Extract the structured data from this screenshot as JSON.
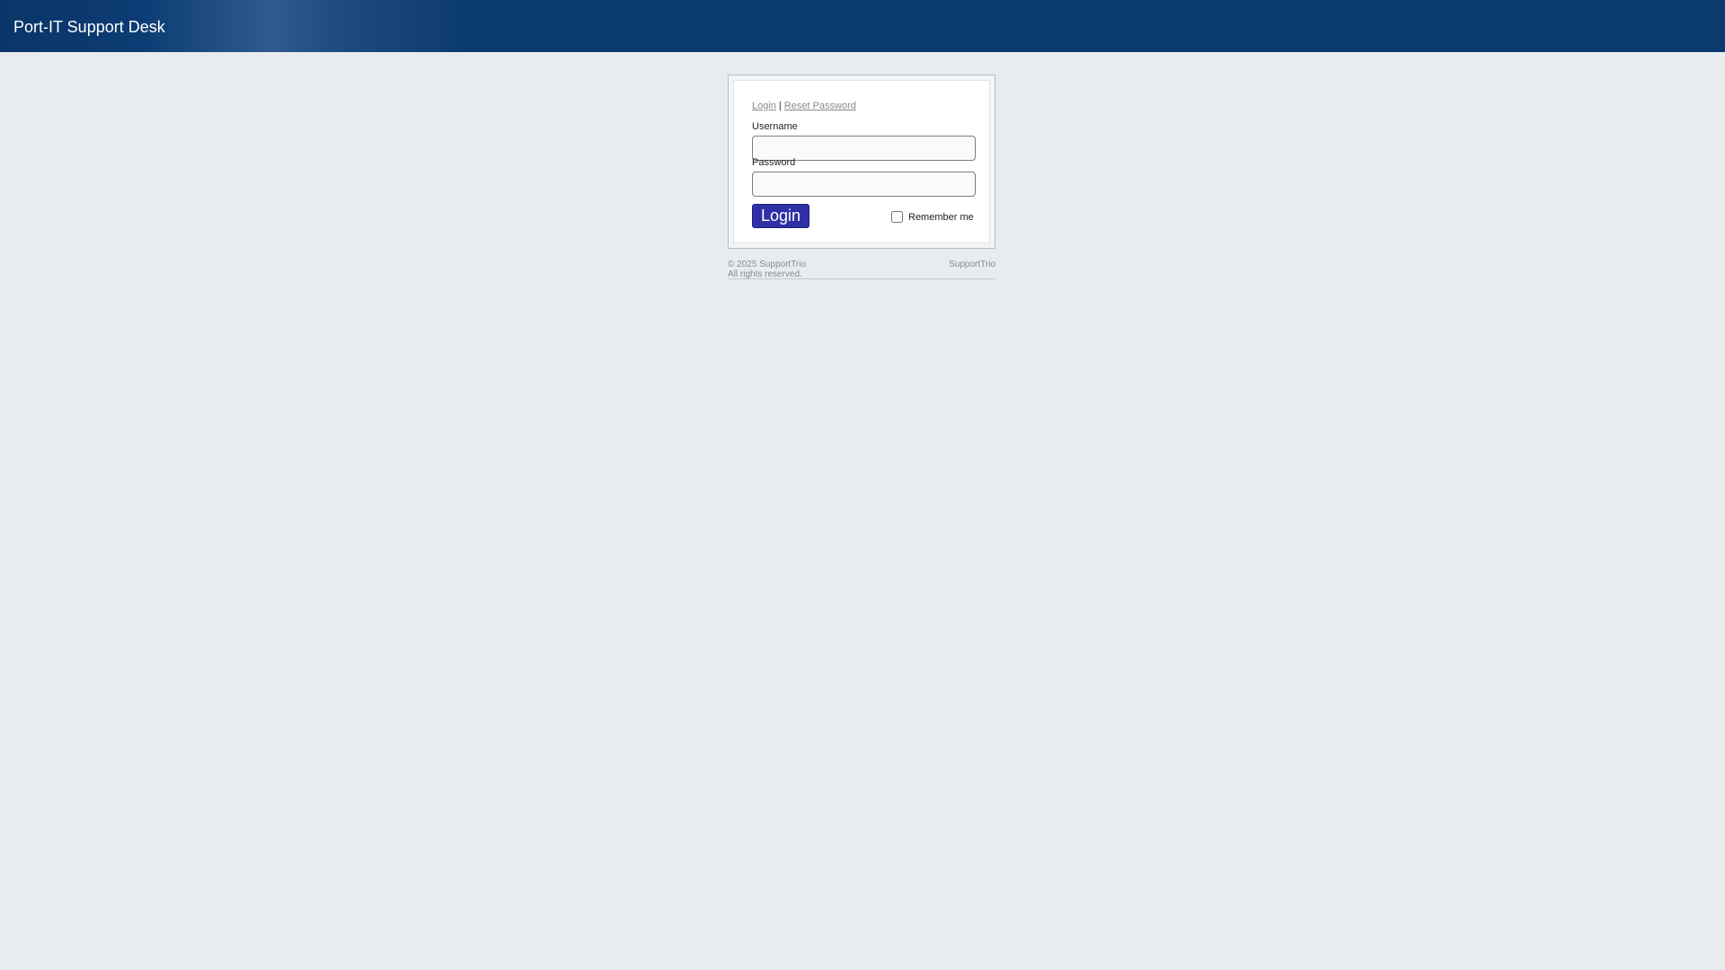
{
  "header": {
    "title": "Port-IT Support Desk"
  },
  "login": {
    "links": {
      "login": "Login",
      "separator": "|",
      "reset_password": "Reset Password"
    },
    "username_label": "Username",
    "username_value": "",
    "password_label": "Password",
    "password_value": "",
    "submit_label": "Login",
    "remember_label": "Remember me",
    "remember_checked": false
  },
  "footer": {
    "copyright": "© 2025 SupportTrio",
    "rights": "All rights reserved.",
    "brand": "SupportTrio"
  },
  "colors": {
    "header_bg": "#0b3a71",
    "page_bg": "#e8ecef",
    "button_bg": "#2f2fa8",
    "link": "#8a8a8a"
  }
}
